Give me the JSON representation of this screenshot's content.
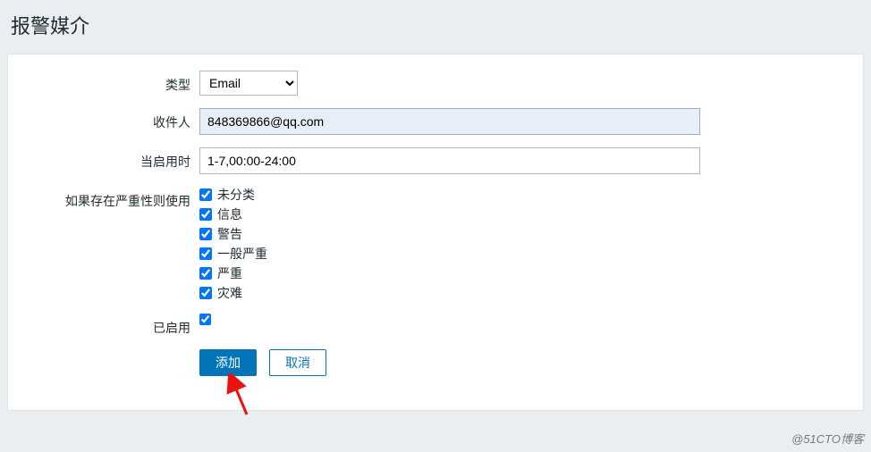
{
  "page": {
    "title": "报警媒介"
  },
  "form": {
    "type_label": "类型",
    "type_value": "Email",
    "recipient_label": "收件人",
    "recipient_value": "848369866@qq.com",
    "when_active_label": "当启用时",
    "when_active_value": "1-7,00:00-24:00",
    "severity_label": "如果存在严重性则使用",
    "severity_options": [
      {
        "label": "未分类",
        "checked": true
      },
      {
        "label": "信息",
        "checked": true
      },
      {
        "label": "警告",
        "checked": true
      },
      {
        "label": "一般严重",
        "checked": true
      },
      {
        "label": "严重",
        "checked": true
      },
      {
        "label": "灾难",
        "checked": true
      }
    ],
    "enabled_label": "已启用",
    "enabled_checked": true
  },
  "buttons": {
    "add": "添加",
    "cancel": "取消"
  },
  "watermark": "@51CTO博客"
}
